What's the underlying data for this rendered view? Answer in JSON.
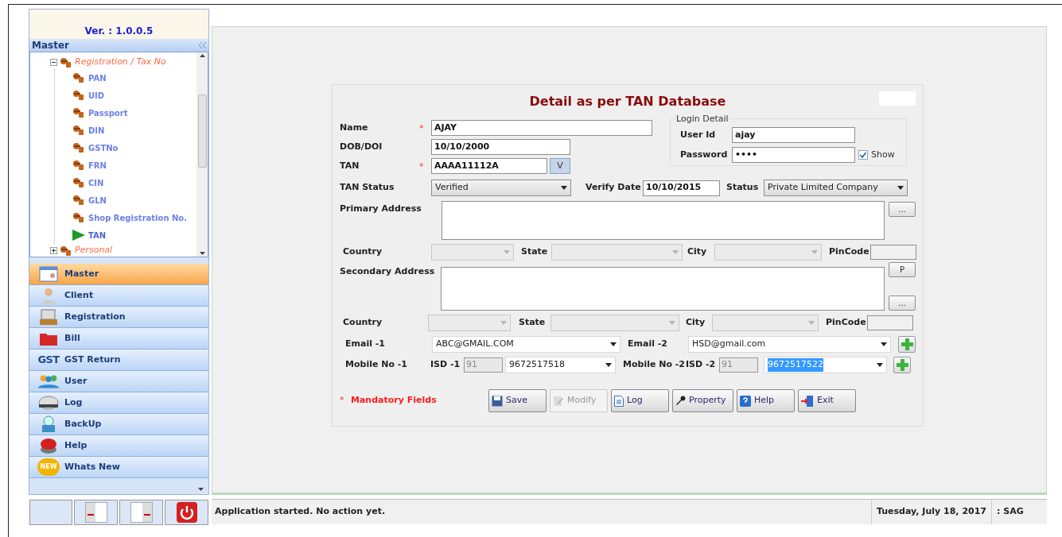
{
  "sidebar": {
    "version": "Ver. : 1.0.0.5",
    "panel_title": "Master",
    "tree": [
      {
        "label": "Registration / Tax No",
        "expanded": true,
        "children": [
          {
            "label": "PAN",
            "selected": false
          },
          {
            "label": "UID",
            "selected": false
          },
          {
            "label": "Passport",
            "selected": false
          },
          {
            "label": "DIN",
            "selected": false
          },
          {
            "label": "GSTNo",
            "selected": false
          },
          {
            "label": "FRN",
            "selected": false
          },
          {
            "label": "CIN",
            "selected": false
          },
          {
            "label": "GLN",
            "selected": false
          },
          {
            "label": "Shop Registration No.",
            "selected": false
          },
          {
            "label": "TAN",
            "selected": true
          }
        ]
      },
      {
        "label": "Personal",
        "expanded": false
      }
    ],
    "nav": [
      {
        "label": "Master",
        "selected": true
      },
      {
        "label": "Client",
        "selected": false
      },
      {
        "label": "Registration",
        "selected": false
      },
      {
        "label": "Bill",
        "selected": false
      },
      {
        "label": "GST Return",
        "selected": false,
        "logo": "GST"
      },
      {
        "label": "User",
        "selected": false
      },
      {
        "label": "Log",
        "selected": false
      },
      {
        "label": "BackUp",
        "selected": false
      },
      {
        "label": "Help",
        "selected": false
      },
      {
        "label": "Whats New",
        "selected": false,
        "logo": "NEW"
      }
    ]
  },
  "form": {
    "title": "Detail as per TAN Database",
    "name": {
      "label": "Name",
      "required": true,
      "value": "AJAY"
    },
    "dob": {
      "label": "DOB/DOI",
      "required": false,
      "value": "10/10/2000"
    },
    "tan": {
      "label": "TAN",
      "required": true,
      "value": "AAAA11112A",
      "button": "V"
    },
    "login": {
      "legend": "Login Detail",
      "user_label": "User Id",
      "user_value": "ajay",
      "password_label": "Password",
      "password_value": "••••",
      "show_label": "Show",
      "show_checked": true
    },
    "tan_status": {
      "label": "TAN Status",
      "value": "Verified"
    },
    "verify_date": {
      "label": "Verify Date",
      "value": "10/10/2015"
    },
    "status": {
      "label": "Status",
      "value": "Private Limited Company"
    },
    "addresses": [
      {
        "label": "Primary Address",
        "buttons": [
          "..."
        ],
        "location": [
          {
            "label": "Country",
            "kind": "select"
          },
          {
            "label": "State",
            "kind": "select"
          },
          {
            "label": "City",
            "kind": "select"
          },
          {
            "label": "PinCode",
            "kind": "text"
          }
        ]
      },
      {
        "label": "Secondary Address",
        "buttons": [
          "P",
          "..."
        ],
        "location": [
          {
            "label": "Country",
            "kind": "select"
          },
          {
            "label": "State",
            "kind": "select"
          },
          {
            "label": "City",
            "kind": "select"
          },
          {
            "label": "PinCode",
            "kind": "text"
          }
        ]
      }
    ],
    "email1": {
      "label": "Email -1",
      "value": "ABC@GMAIL.COM"
    },
    "email2": {
      "label": "Email -2",
      "value": "HSD@gmail.com"
    },
    "mobile1": {
      "label": "Mobile No -1",
      "isd_label": "ISD -1",
      "isd": "91",
      "value": "9672517518",
      "selected": false
    },
    "mobile2": {
      "label": "Mobile No -2",
      "isd_label": "ISD -2",
      "isd": "91",
      "value": "9672517522",
      "selected": true
    },
    "mandatory": {
      "star": "*",
      "text": "Mandatory Fields"
    },
    "buttons": [
      {
        "label": "Save",
        "disabled": false
      },
      {
        "label": "Modify",
        "disabled": true
      },
      {
        "label": "Log",
        "disabled": false
      },
      {
        "label": "Property",
        "disabled": false
      },
      {
        "label": "Help",
        "disabled": false
      },
      {
        "label": "Exit",
        "disabled": false
      }
    ]
  },
  "status_bar": {
    "message": "Application started. No action yet.",
    "date": "Tuesday, July 18, 2017",
    "user": ": SAG"
  }
}
